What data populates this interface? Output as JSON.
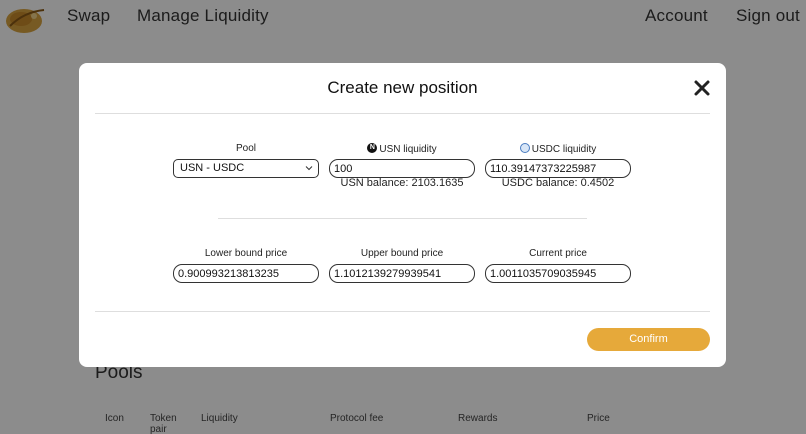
{
  "nav": {
    "swap": "Swap",
    "manage_liquidity": "Manage Liquidity",
    "account": "Account",
    "sign_out": "Sign out"
  },
  "pools_section": {
    "title": "Pools",
    "columns": [
      "Icon",
      "Token pair",
      "Liquidity",
      "Protocol fee",
      "Rewards",
      "Price"
    ]
  },
  "modal": {
    "title": "Create new position",
    "pool": {
      "label": "Pool",
      "selected": "USN - USDC"
    },
    "usn": {
      "label": "USN liquidity",
      "value": "100",
      "balance": "USN balance: 2103.1635"
    },
    "usdc": {
      "label": "USDC liquidity",
      "value": "110.39147373225987",
      "balance": "USDC balance: 0.4502"
    },
    "lower": {
      "label": "Lower bound price",
      "value": "0.900993213813235"
    },
    "upper": {
      "label": "Upper bound price",
      "value": "1.1012139279939541"
    },
    "current": {
      "label": "Current price",
      "value": "1.0011035709035945"
    },
    "confirm": "Confirm"
  },
  "colors": {
    "accent": "#e6a93a",
    "overlay": "rgba(0,0,0,0.45)"
  }
}
